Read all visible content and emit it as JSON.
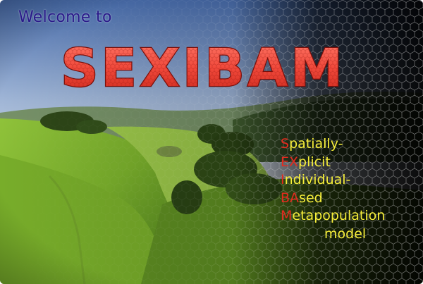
{
  "welcome_text": "Welcome to",
  "title": "SEXIBAM",
  "acronym": [
    {
      "highlight": "S",
      "rest": "patially-"
    },
    {
      "highlight": "EX",
      "rest": "plicit"
    },
    {
      "highlight": "I",
      "rest": "ndividual-"
    },
    {
      "highlight": "BA",
      "rest": "sed"
    },
    {
      "highlight": "M",
      "rest": "etapopulation"
    },
    {
      "highlight": "",
      "rest": "model"
    }
  ],
  "colors": {
    "welcome": "#2a1a8a",
    "title_fill": "#f0483a",
    "title_outline": "#7a0f0a",
    "acronym_text": "#f6ee3a",
    "acronym_highlight": "#e52a1e"
  }
}
